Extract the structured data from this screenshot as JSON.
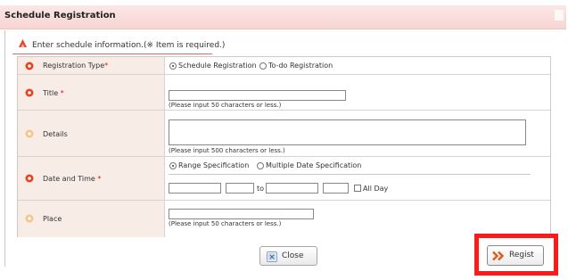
{
  "dialog": {
    "title": "Schedule Registration"
  },
  "instruction": {
    "text": "Enter schedule information.(※ Item is required.)"
  },
  "form": {
    "registration_type": {
      "label": "Registration Type",
      "required_mark": "*",
      "options": [
        "Schedule Registration",
        "To-do Registration"
      ],
      "selected": "Schedule Registration"
    },
    "title": {
      "label": "Title",
      "required_mark": "*",
      "value": "",
      "hint": "(Please input 50 characters or less.)"
    },
    "details": {
      "label": "Details",
      "value": "",
      "hint": "(Please input 500 characters or less.)"
    },
    "date_time": {
      "label": "Date and Time",
      "required_mark": "*",
      "options": [
        "Range Specification",
        "Multiple Date Specification"
      ],
      "selected": "Range Specification",
      "to_label": "to",
      "all_day_label": "All Day",
      "all_day_checked": false
    },
    "place": {
      "label": "Place",
      "value": "",
      "hint": "(Please input 50 characters or less.)"
    }
  },
  "buttons": {
    "close_label": "Close",
    "regist_label": "Regist"
  },
  "colors": {
    "required_icon": "#e8431f",
    "optional_icon": "#f4c48a",
    "highlight_border": "#ff1a1a",
    "header_bg": "#f7d5d3",
    "label_bg": "#f8ece6"
  },
  "icons": {
    "instruction": "arrow-icon",
    "required": "required-bullet-icon",
    "optional": "optional-bullet-icon",
    "close": "close-x-icon",
    "regist": "double-chevron-right-icon"
  }
}
